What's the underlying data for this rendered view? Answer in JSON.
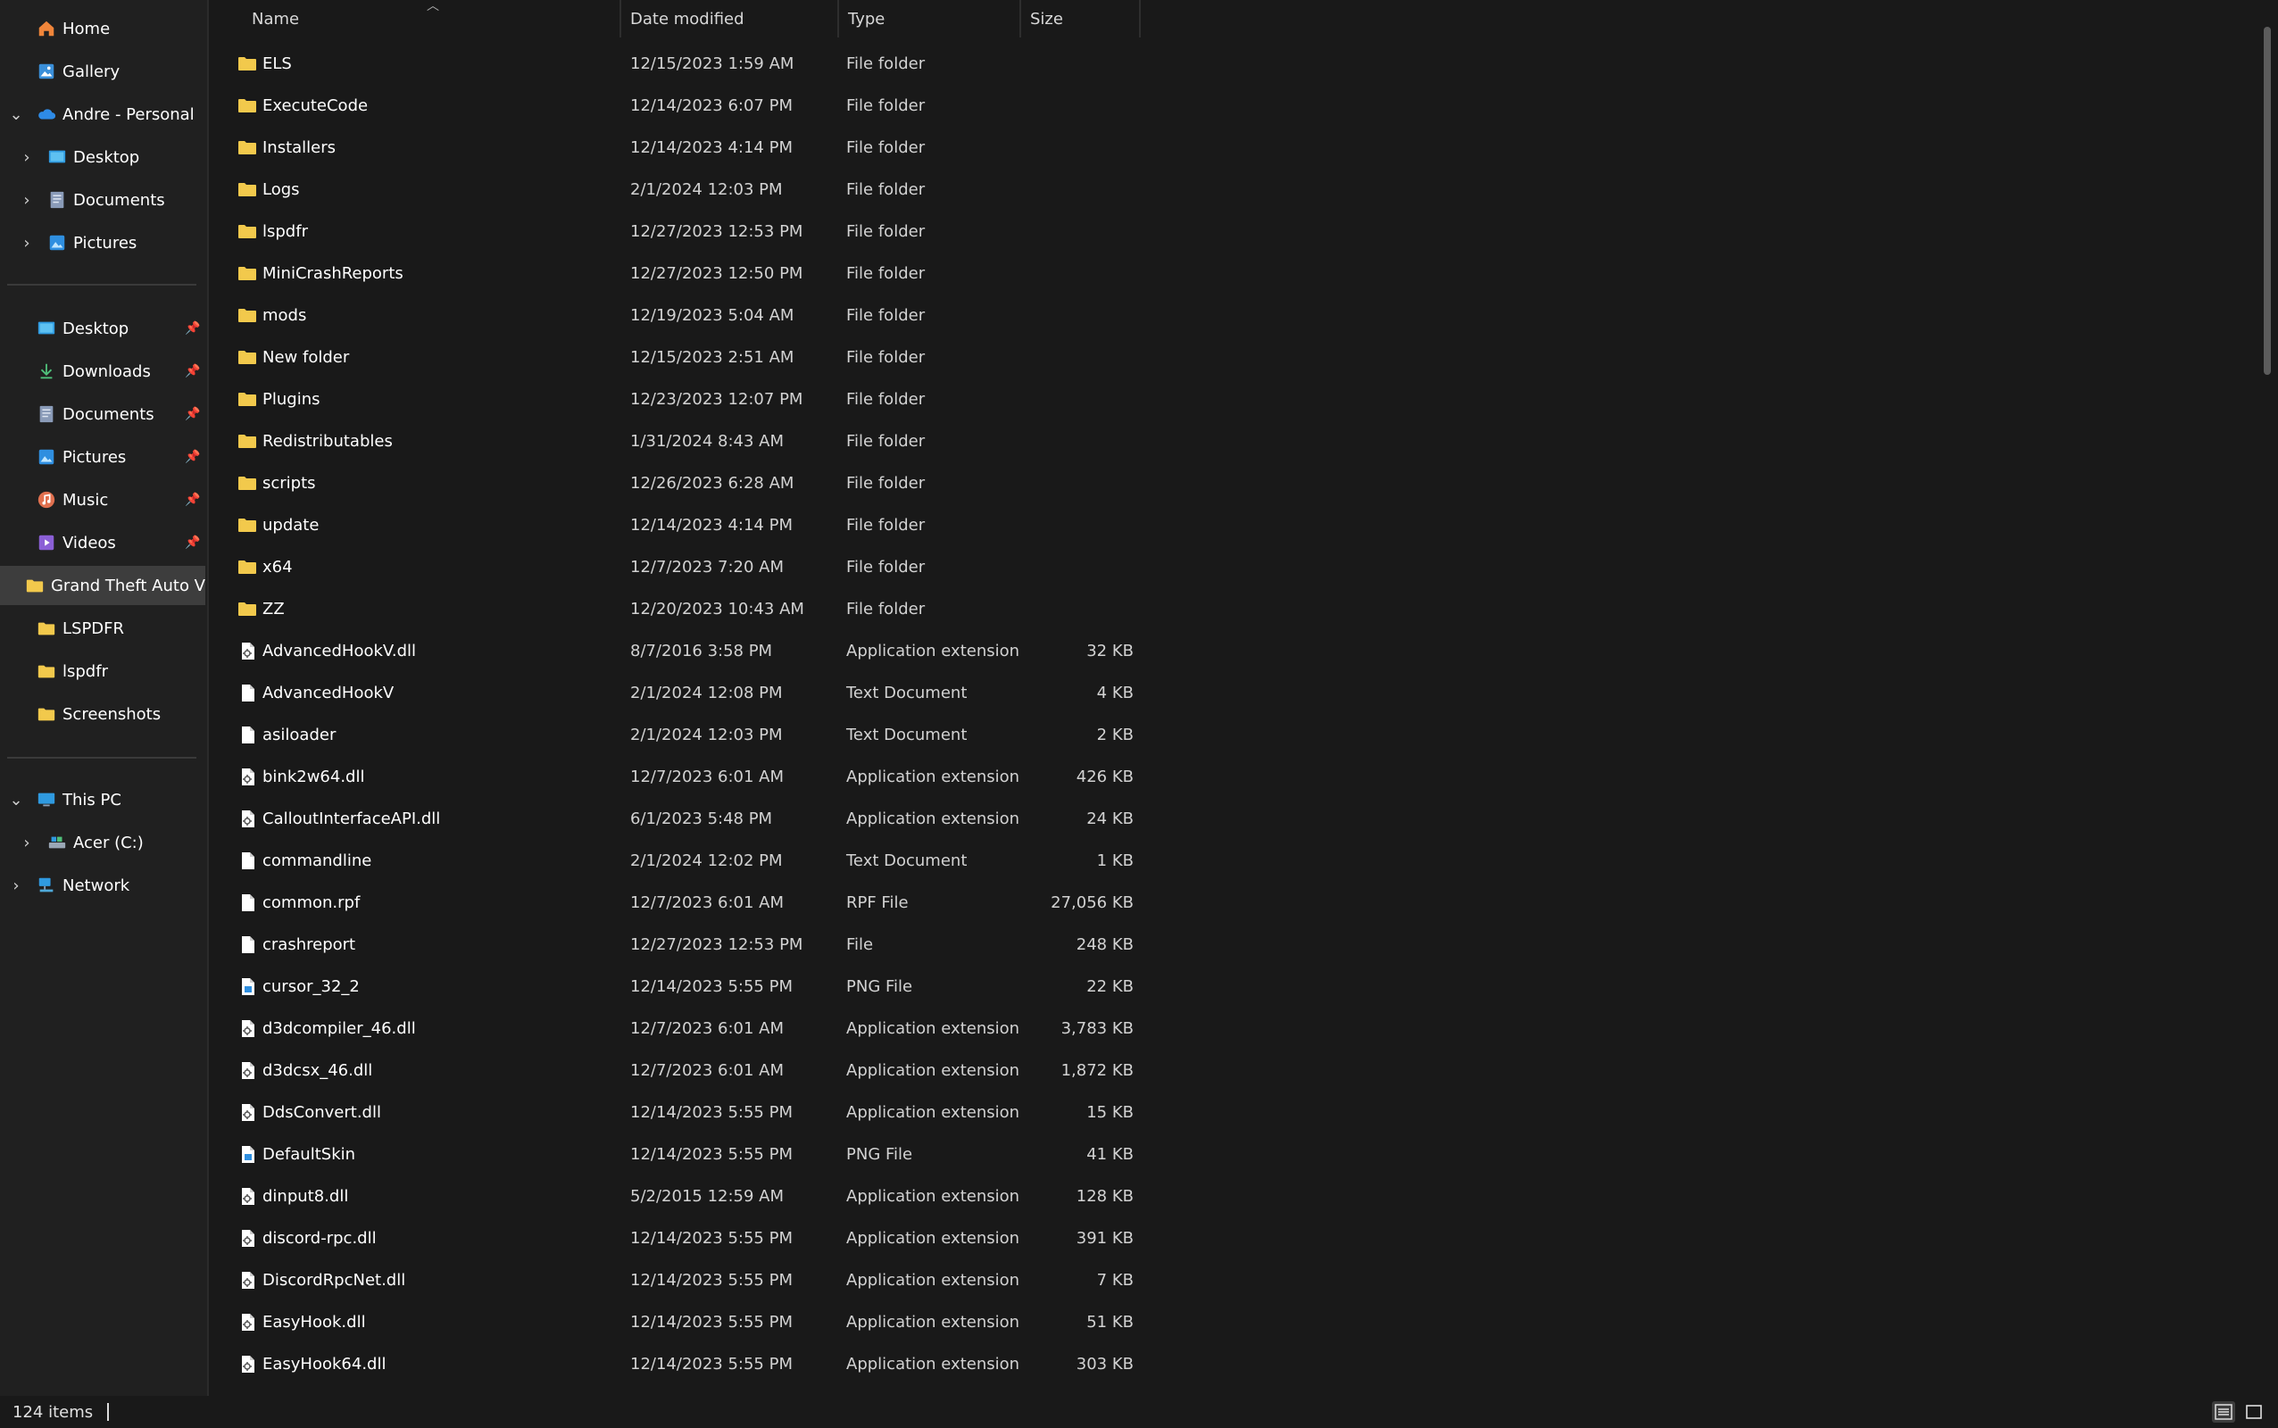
{
  "sidebar": {
    "top_items": [
      {
        "label": "Home",
        "icon": "home-icon"
      },
      {
        "label": "Gallery",
        "icon": "gallery-icon"
      },
      {
        "label": "Andre - Personal",
        "icon": "onedrive-cloud-icon"
      },
      {
        "label": "Desktop",
        "icon": "desktop-icon"
      },
      {
        "label": "Documents",
        "icon": "documents-icon"
      },
      {
        "label": "Pictures",
        "icon": "pictures-icon"
      }
    ],
    "quick_access": [
      {
        "label": "Desktop",
        "icon": "desktop-icon",
        "pinned": true
      },
      {
        "label": "Downloads",
        "icon": "downloads-icon",
        "pinned": true
      },
      {
        "label": "Documents",
        "icon": "documents-icon",
        "pinned": true
      },
      {
        "label": "Pictures",
        "icon": "pictures-icon",
        "pinned": true
      },
      {
        "label": "Music",
        "icon": "music-icon",
        "pinned": true
      },
      {
        "label": "Videos",
        "icon": "videos-icon",
        "pinned": true
      },
      {
        "label": "Grand Theft Auto V",
        "icon": "folder-icon",
        "pinned": false,
        "selected": true
      },
      {
        "label": "LSPDFR",
        "icon": "folder-icon",
        "pinned": false
      },
      {
        "label": "lspdfr",
        "icon": "folder-icon",
        "pinned": false
      },
      {
        "label": "Screenshots",
        "icon": "folder-icon",
        "pinned": false
      }
    ],
    "bottom_items": [
      {
        "label": "This PC",
        "icon": "this-pc-icon"
      },
      {
        "label": "Acer (C:)",
        "icon": "drive-icon"
      },
      {
        "label": "Network",
        "icon": "network-icon"
      }
    ]
  },
  "columns": {
    "name": "Name",
    "date": "Date modified",
    "type": "Type",
    "size": "Size"
  },
  "files": [
    {
      "name": "ELS",
      "date": "12/15/2023 1:59 AM",
      "type": "File folder",
      "size": "",
      "kind": "folder"
    },
    {
      "name": "ExecuteCode",
      "date": "12/14/2023 6:07 PM",
      "type": "File folder",
      "size": "",
      "kind": "folder"
    },
    {
      "name": "Installers",
      "date": "12/14/2023 4:14 PM",
      "type": "File folder",
      "size": "",
      "kind": "folder"
    },
    {
      "name": "Logs",
      "date": "2/1/2024 12:03 PM",
      "type": "File folder",
      "size": "",
      "kind": "folder"
    },
    {
      "name": "lspdfr",
      "date": "12/27/2023 12:53 PM",
      "type": "File folder",
      "size": "",
      "kind": "folder"
    },
    {
      "name": "MiniCrashReports",
      "date": "12/27/2023 12:50 PM",
      "type": "File folder",
      "size": "",
      "kind": "folder"
    },
    {
      "name": "mods",
      "date": "12/19/2023 5:04 AM",
      "type": "File folder",
      "size": "",
      "kind": "folder"
    },
    {
      "name": "New folder",
      "date": "12/15/2023 2:51 AM",
      "type": "File folder",
      "size": "",
      "kind": "folder"
    },
    {
      "name": "Plugins",
      "date": "12/23/2023 12:07 PM",
      "type": "File folder",
      "size": "",
      "kind": "folder"
    },
    {
      "name": "Redistributables",
      "date": "1/31/2024 8:43 AM",
      "type": "File folder",
      "size": "",
      "kind": "folder"
    },
    {
      "name": "scripts",
      "date": "12/26/2023 6:28 AM",
      "type": "File folder",
      "size": "",
      "kind": "folder"
    },
    {
      "name": "update",
      "date": "12/14/2023 4:14 PM",
      "type": "File folder",
      "size": "",
      "kind": "folder"
    },
    {
      "name": "x64",
      "date": "12/7/2023 7:20 AM",
      "type": "File folder",
      "size": "",
      "kind": "folder"
    },
    {
      "name": "ZZ",
      "date": "12/20/2023 10:43 AM",
      "type": "File folder",
      "size": "",
      "kind": "folder"
    },
    {
      "name": "AdvancedHookV.dll",
      "date": "8/7/2016 3:58 PM",
      "type": "Application extension",
      "size": "32 KB",
      "kind": "dll"
    },
    {
      "name": "AdvancedHookV",
      "date": "2/1/2024 12:08 PM",
      "type": "Text Document",
      "size": "4 KB",
      "kind": "text"
    },
    {
      "name": "asiloader",
      "date": "2/1/2024 12:03 PM",
      "type": "Text Document",
      "size": "2 KB",
      "kind": "text"
    },
    {
      "name": "bink2w64.dll",
      "date": "12/7/2023 6:01 AM",
      "type": "Application extension",
      "size": "426 KB",
      "kind": "dll"
    },
    {
      "name": "CalloutInterfaceAPI.dll",
      "date": "6/1/2023 5:48 PM",
      "type": "Application extension",
      "size": "24 KB",
      "kind": "dll"
    },
    {
      "name": "commandline",
      "date": "2/1/2024 12:02 PM",
      "type": "Text Document",
      "size": "1 KB",
      "kind": "text"
    },
    {
      "name": "common.rpf",
      "date": "12/7/2023 6:01 AM",
      "type": "RPF File",
      "size": "27,056 KB",
      "kind": "file"
    },
    {
      "name": "crashreport",
      "date": "12/27/2023 12:53 PM",
      "type": "File",
      "size": "248 KB",
      "kind": "file"
    },
    {
      "name": "cursor_32_2",
      "date": "12/14/2023 5:55 PM",
      "type": "PNG File",
      "size": "22 KB",
      "kind": "png"
    },
    {
      "name": "d3dcompiler_46.dll",
      "date": "12/7/2023 6:01 AM",
      "type": "Application extension",
      "size": "3,783 KB",
      "kind": "dll"
    },
    {
      "name": "d3dcsx_46.dll",
      "date": "12/7/2023 6:01 AM",
      "type": "Application extension",
      "size": "1,872 KB",
      "kind": "dll"
    },
    {
      "name": "DdsConvert.dll",
      "date": "12/14/2023 5:55 PM",
      "type": "Application extension",
      "size": "15 KB",
      "kind": "dll"
    },
    {
      "name": "DefaultSkin",
      "date": "12/14/2023 5:55 PM",
      "type": "PNG File",
      "size": "41 KB",
      "kind": "png"
    },
    {
      "name": "dinput8.dll",
      "date": "5/2/2015 12:59 AM",
      "type": "Application extension",
      "size": "128 KB",
      "kind": "dll"
    },
    {
      "name": "discord-rpc.dll",
      "date": "12/14/2023 5:55 PM",
      "type": "Application extension",
      "size": "391 KB",
      "kind": "dll"
    },
    {
      "name": "DiscordRpcNet.dll",
      "date": "12/14/2023 5:55 PM",
      "type": "Application extension",
      "size": "7 KB",
      "kind": "dll"
    },
    {
      "name": "EasyHook.dll",
      "date": "12/14/2023 5:55 PM",
      "type": "Application extension",
      "size": "51 KB",
      "kind": "dll"
    },
    {
      "name": "EasyHook64.dll",
      "date": "12/14/2023 5:55 PM",
      "type": "Application extension",
      "size": "303 KB",
      "kind": "dll"
    }
  ],
  "status": {
    "item_count": "124 items"
  },
  "colors": {
    "folder": "#f2c94c",
    "accent": "#3d3d3d",
    "background": "#191919",
    "sidebar": "#202020"
  }
}
